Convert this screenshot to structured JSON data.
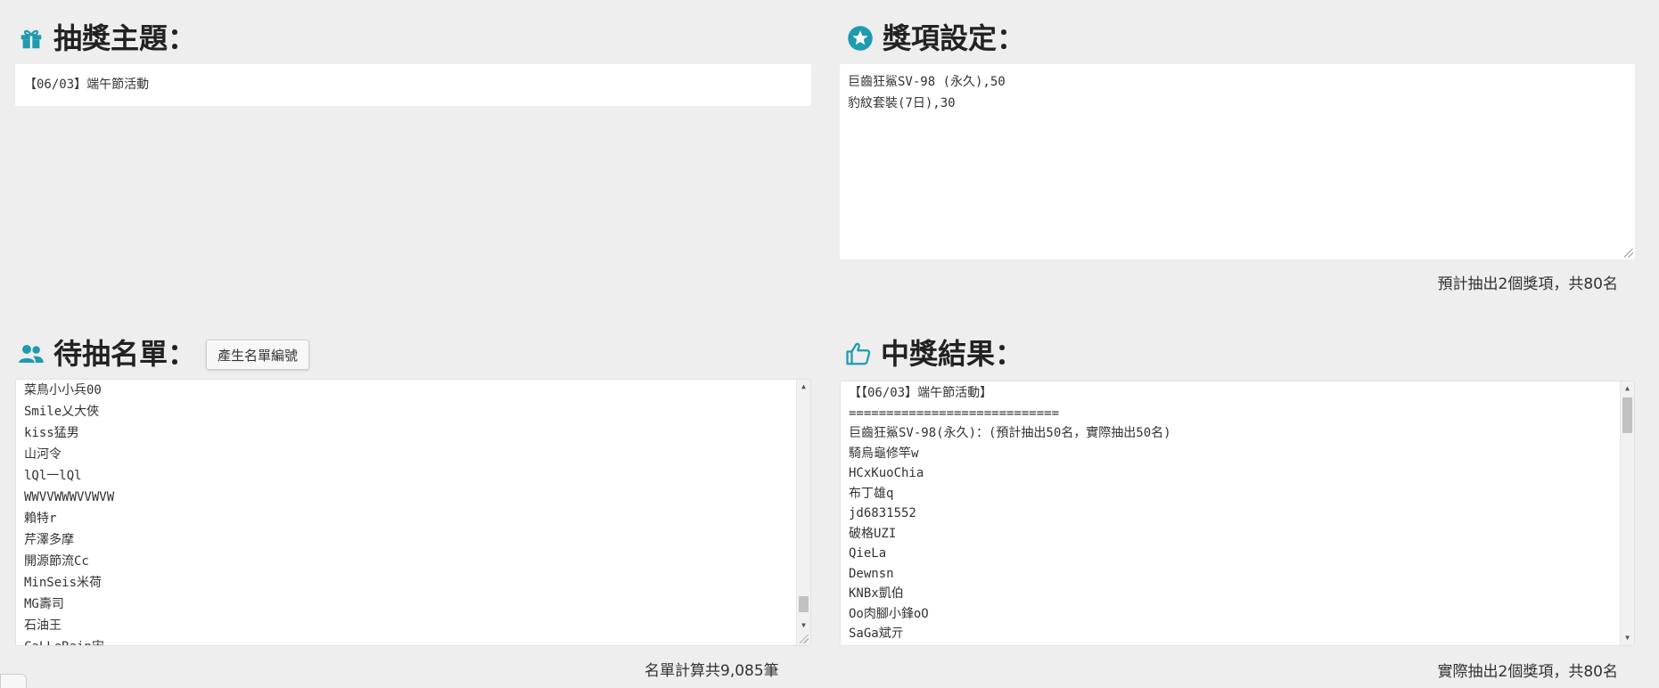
{
  "theme": {
    "heading": "抽獎主題：",
    "value": "【06/03】端午節活動"
  },
  "prizes": {
    "heading": "獎項設定：",
    "lines": [
      "巨齒狂鯊SV-98 (永久),50",
      "豹紋套裝(7日),30"
    ],
    "summary": "預計抽出2個獎項，共80名"
  },
  "participants": {
    "heading": "待抽名單：",
    "generate_button": "產生名單編號",
    "names": [
      "菜鳥小小兵00",
      "Smile乂大俠",
      "kiss猛男",
      "山河令",
      "lQl一lQl",
      "WWVVWWWVVWVW",
      "賴特r",
      "芹澤多摩",
      "開源節流Cc",
      "MinSeis米荷",
      "MG壽司",
      "石油王",
      "CaLLeRain宋"
    ],
    "summary": "名單計算共9,085筆"
  },
  "results": {
    "heading": "中獎結果：",
    "lines": [
      "【【06/03】端午節活動】",
      "============================",
      "巨齒狂鯊SV-98(永久)：(預計抽出50名，實際抽出50名)",
      "騎烏龜修竿w",
      "HCxKuoChia",
      "布丁雄q",
      "jd6831552",
      "破格UZI",
      "QieLa",
      "Dewnsn",
      "KNBx凱伯",
      "Oo肉腳小鋒oO",
      "SaGa斌亓"
    ],
    "summary": "實際抽出2個獎項，共80名"
  },
  "colors": {
    "icon_teal": "#1f9bb0"
  }
}
